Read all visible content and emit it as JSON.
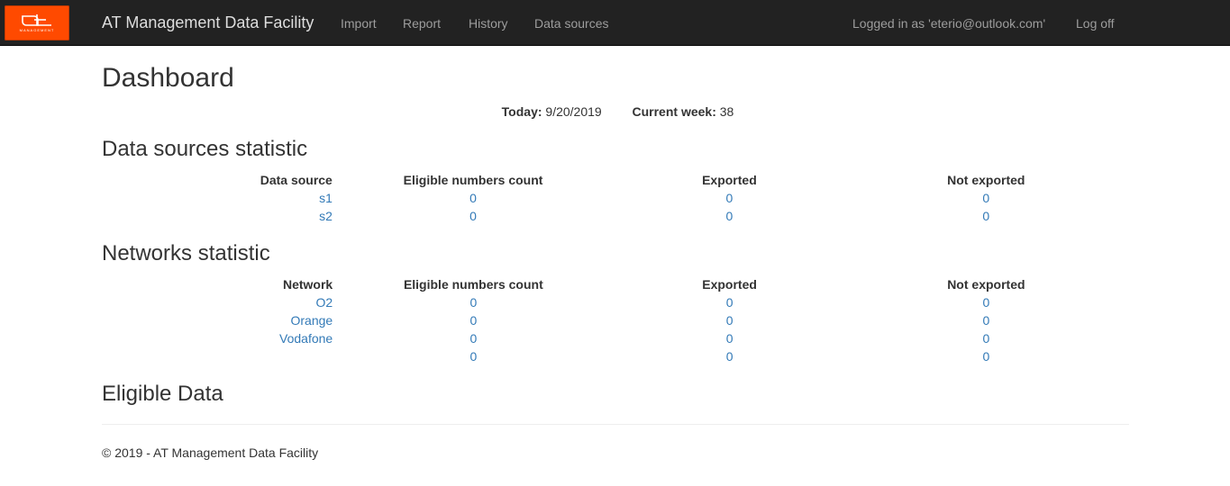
{
  "nav": {
    "logo_text": "MANAGEMENT",
    "brand": "AT Management Data Facility",
    "links": [
      "Import",
      "Report",
      "History",
      "Data sources"
    ],
    "logged_in": "Logged in as 'eterio@outlook.com'",
    "logoff": "Log off"
  },
  "page": {
    "title": "Dashboard",
    "today_label": "Today:",
    "today_value": "9/20/2019",
    "week_label": "Current week:",
    "week_value": "38"
  },
  "data_sources": {
    "title": "Data sources statistic",
    "headers": [
      "Data source",
      "Eligible numbers count",
      "Exported",
      "Not exported"
    ],
    "rows": [
      {
        "name": "s1",
        "eligible": "0",
        "exported": "0",
        "not_exported": "0"
      },
      {
        "name": "s2",
        "eligible": "0",
        "exported": "0",
        "not_exported": "0"
      }
    ]
  },
  "networks": {
    "title": "Networks statistic",
    "headers": [
      "Network",
      "Eligible numbers count",
      "Exported",
      "Not exported"
    ],
    "rows": [
      {
        "name": "O2",
        "eligible": "0",
        "exported": "0",
        "not_exported": "0"
      },
      {
        "name": "Orange",
        "eligible": "0",
        "exported": "0",
        "not_exported": "0"
      },
      {
        "name": "Vodafone",
        "eligible": "0",
        "exported": "0",
        "not_exported": "0"
      },
      {
        "name": "",
        "eligible": "0",
        "exported": "0",
        "not_exported": "0"
      }
    ]
  },
  "eligible_data": {
    "title": "Eligible Data"
  },
  "footer": {
    "text": "© 2019 - AT Management Data Facility"
  }
}
